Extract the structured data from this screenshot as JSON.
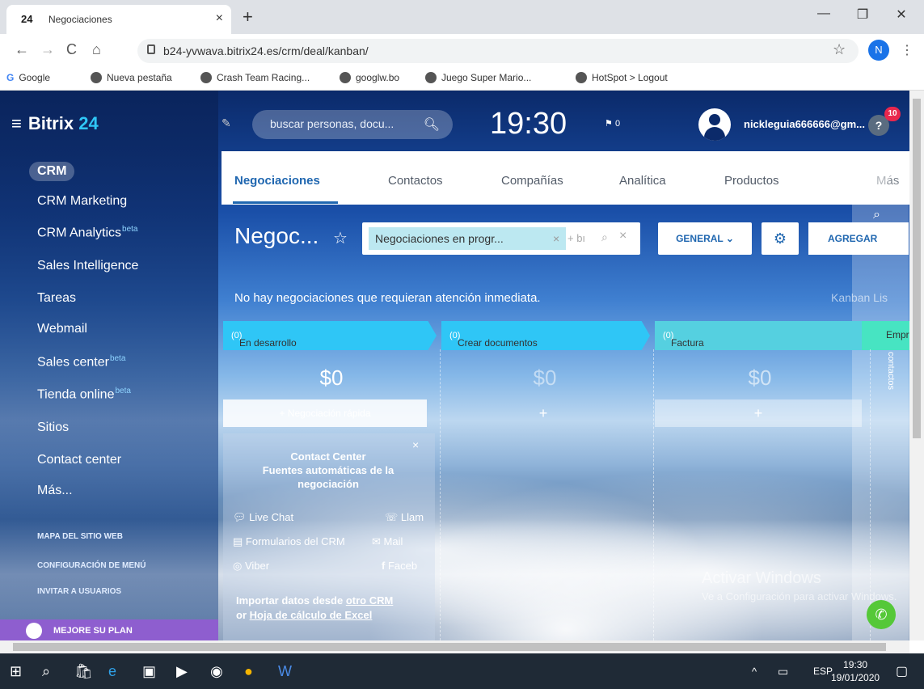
{
  "browser": {
    "tab_title": "Negociaciones",
    "tab_favicon": "24",
    "url": "b24-yvwava.bitrix24.es/crm/deal/kanban/",
    "profile_initial": "N",
    "bookmarks": [
      "Google",
      "Nueva pestaña",
      "Crash Team Racing...",
      "googlw.bo",
      "Juego Super Mario...",
      "HotSpot > Logout"
    ]
  },
  "app": {
    "logo_main": "Bitrix",
    "logo_num": "24",
    "search_placeholder": "buscar personas, docu...",
    "clock": "19:30",
    "flag_count": "0",
    "username": "nickleguia666666@gm...",
    "notif_badge": "10",
    "sidebar": {
      "active": "CRM",
      "items": [
        {
          "label": "CRM Marketing",
          "sup": ""
        },
        {
          "label": "CRM Analytics",
          "sup": "beta"
        },
        {
          "label": "Sales Intelligence",
          "sup": ""
        },
        {
          "label": "Tareas",
          "sup": ""
        },
        {
          "label": "Webmail",
          "sup": ""
        },
        {
          "label": "Sales center",
          "sup": "beta"
        },
        {
          "label": "Tienda online",
          "sup": "beta"
        },
        {
          "label": "Sitios",
          "sup": ""
        },
        {
          "label": "Contact center",
          "sup": ""
        },
        {
          "label": "Más...",
          "sup": ""
        }
      ],
      "links": [
        "MAPA DEL SITIO WEB",
        "CONFIGURACIÓN DE MENÚ",
        "INVITAR A USUARIOS"
      ],
      "upgrade": "MEJORE SU PLAN"
    },
    "tabs": [
      "Negociaciones",
      "Contactos",
      "Compañías",
      "Analítica",
      "Productos",
      "Más"
    ],
    "page_title": "Negoc...",
    "filter_chip": "Negociaciones en progr...",
    "filter_plus": "+ bı",
    "btn_general": "GENERAL",
    "btn_add": "AGREGAR",
    "notice": "No hay negociaciones que requieran atención inmediata.",
    "view_mode": "Kanban  Lis",
    "right_panel_text": "No hay contactos",
    "columns": [
      {
        "name": "En desarrollo",
        "count": "(0)",
        "sum": "$0",
        "color": "#2fc6f6"
      },
      {
        "name": "Crear documentos",
        "count": "(0)",
        "sum": "$0",
        "color": "#2fc6f6"
      },
      {
        "name": "Factura",
        "count": "(0)",
        "sum": "$0",
        "color": "#55d0e0"
      },
      {
        "name": "Empre",
        "count": "",
        "sum": "",
        "color": "#47e4c2"
      }
    ],
    "quick_deal": "+ Negociación rápida",
    "contact_center": {
      "title": "Contact Center",
      "subtitle": "Fuentes automáticas de la negociación",
      "items": [
        "Live Chat",
        "Llam",
        "Formularios del CRM",
        "Mail",
        "Viber",
        "Faceb"
      ],
      "import_prefix": "Importar datos desde",
      "import_link1": "otro CRM",
      "import_or": "or",
      "import_link2": "Hoja de cálculo de Excel"
    },
    "watermark_title": "Activar Windows",
    "watermark_sub": "Ve a Configuración para activar Windows."
  },
  "taskbar": {
    "lang": "ESP",
    "time": "19:30",
    "date": "19/01/2020"
  }
}
